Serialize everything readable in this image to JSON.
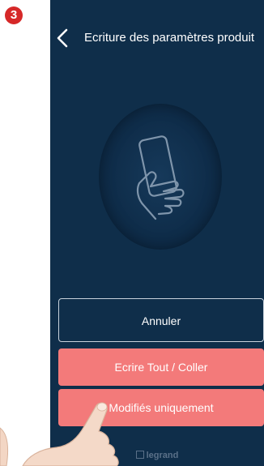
{
  "step_badge": "3",
  "header": {
    "title": "Ecriture des paramètres produit",
    "back_icon": "chevron-left-icon"
  },
  "illustration": {
    "icon": "hand-holding-phone-icon"
  },
  "buttons": {
    "cancel_label": "Annuler",
    "write_all_label": "Ecrire Tout / Coller",
    "modified_only_label": "Modifiés uniquement"
  },
  "footer": {
    "brand": "legrand",
    "brand_icon": "legrand-logo-icon"
  },
  "colors": {
    "background": "#0f2e4a",
    "accent_button": "#f37a7a",
    "badge": "#d62828"
  }
}
